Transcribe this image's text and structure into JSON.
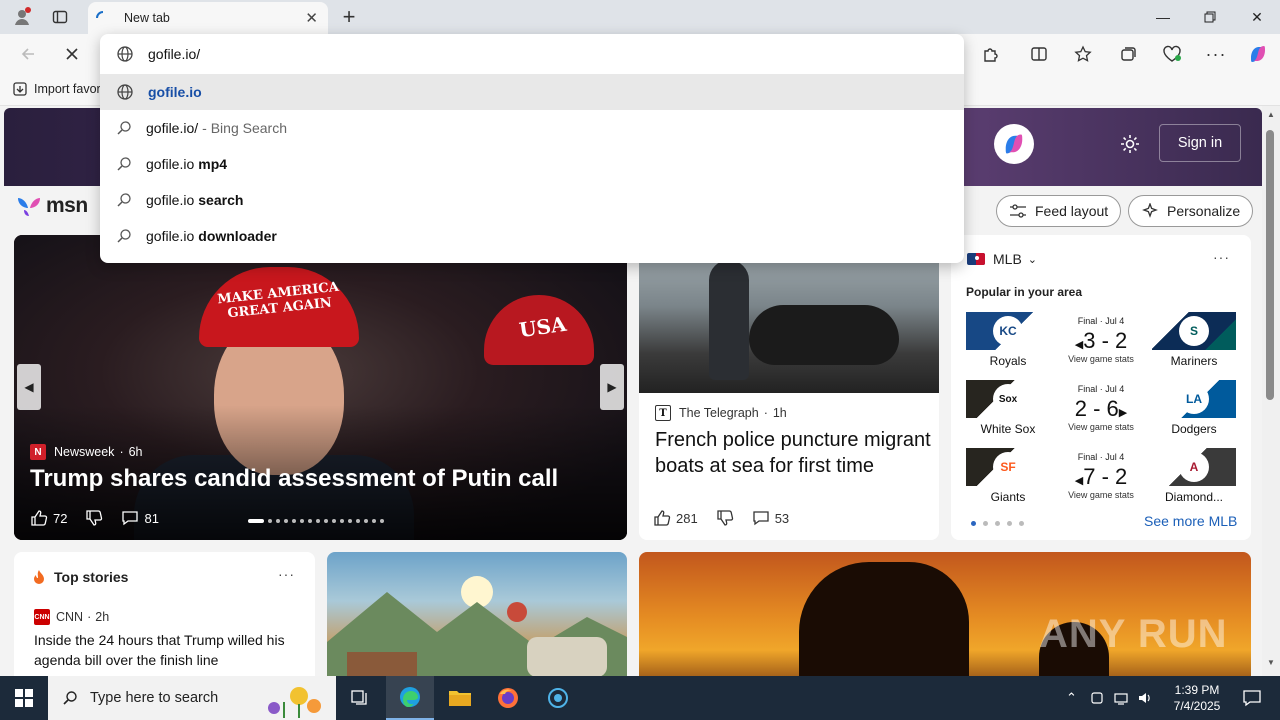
{
  "browser": {
    "tab_title": "New tab",
    "address_value": "gofile.io/",
    "import_favorites": "Import favor"
  },
  "suggestions": [
    {
      "text": "gofile.io",
      "suffix": "",
      "icon": "globe-icon"
    },
    {
      "text": "gofile.io/",
      "suffix": "- Bing Search",
      "icon": "search-icon"
    },
    {
      "text": "gofile.io",
      "suffix": "mp4",
      "icon": "search-icon"
    },
    {
      "text": "gofile.io",
      "suffix": "search",
      "icon": "search-icon"
    },
    {
      "text": "gofile.io",
      "suffix": "downloader",
      "icon": "search-icon"
    }
  ],
  "msn": {
    "logo_text": "msn",
    "sign_in": "Sign in",
    "feed_layout": "Feed layout",
    "personalize": "Personalize"
  },
  "carousel": {
    "source": "Newsweek",
    "age": "6h",
    "headline": "Trump shares candid assessment of Putin call",
    "likes": "72",
    "comments": "81",
    "cap_text": "MAKE AMERICA GREAT AGAIN",
    "usa_text": "USA"
  },
  "news2": {
    "source": "The Telegraph",
    "age": "1h",
    "headline": "French police puncture migrant boats at sea for first time",
    "likes": "281",
    "comments": "53"
  },
  "mlb": {
    "title": "MLB",
    "subtitle": "Popular in your area",
    "see_more": "See more MLB",
    "games": [
      {
        "status": "Final · Jul 4",
        "score": "3 - 2",
        "link": "View game stats",
        "home": "Royals",
        "away": "Mariners",
        "home_abbr": "KC",
        "away_abbr": "S",
        "home_color": "#174885",
        "away_color": "#0c2c56"
      },
      {
        "status": "Final · Jul 4",
        "score": "2 - 6",
        "link": "View game stats",
        "home": "White Sox",
        "away": "Dodgers",
        "home_abbr": "Sox",
        "away_abbr": "LA",
        "home_color": "#27251f",
        "away_color": "#005a9c"
      },
      {
        "status": "Final · Jul 4",
        "score": "7 - 2",
        "link": "View game stats",
        "home": "Giants",
        "away": "Diamond...",
        "home_abbr": "SF",
        "away_abbr": "A",
        "home_color": "#27251f",
        "away_color": "#3a3a3a"
      }
    ]
  },
  "top_stories": {
    "title": "Top stories",
    "source": "CNN",
    "age": "2h",
    "headline": "Inside the 24 hours that Trump willed his agenda bill over the finish line"
  },
  "watermark": "ANY RUN",
  "taskbar": {
    "search_placeholder": "Type here to search",
    "time": "1:39 PM",
    "date": "7/4/2025"
  }
}
